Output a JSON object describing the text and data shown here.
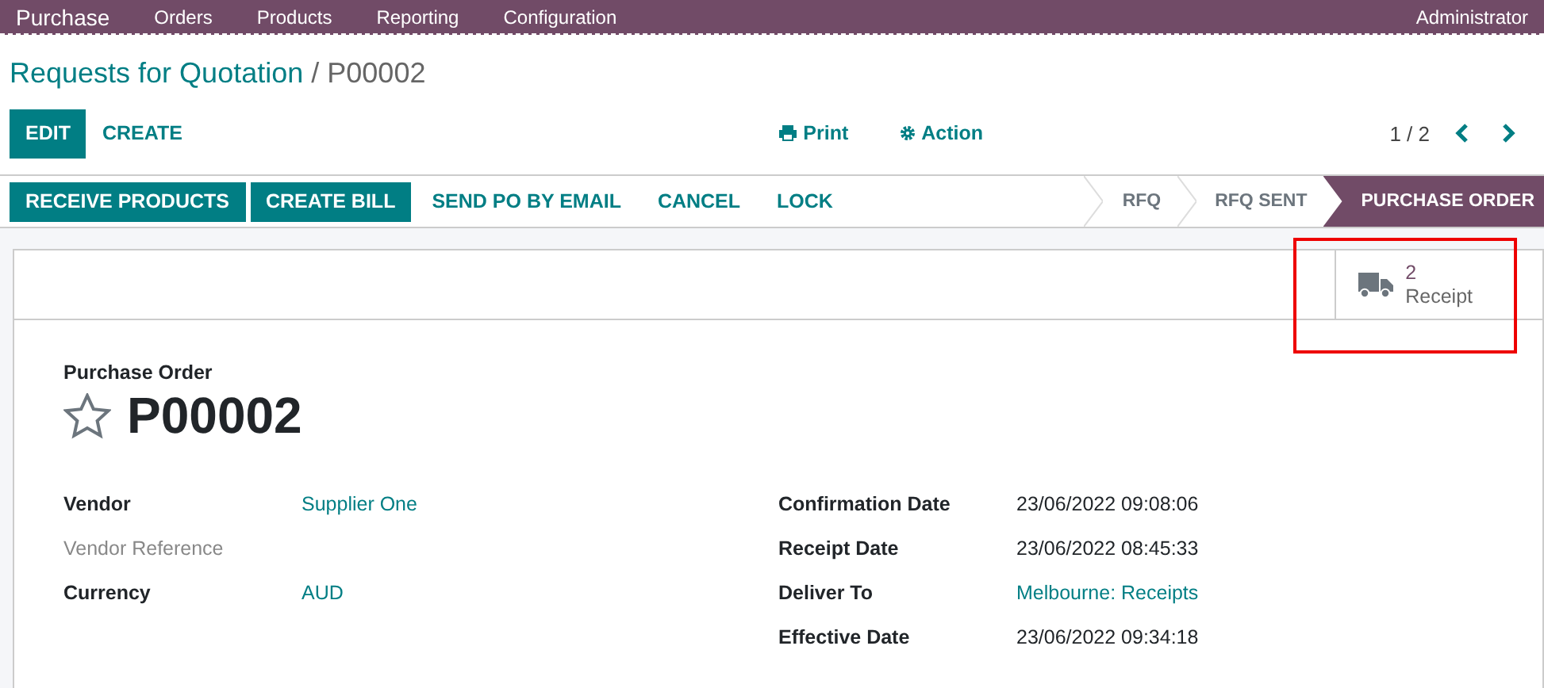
{
  "navbar": {
    "app": "Purchase",
    "menus": [
      "Orders",
      "Products",
      "Reporting",
      "Configuration"
    ],
    "user": "Administrator"
  },
  "breadcrumb": {
    "parent": "Requests for Quotation",
    "separator": "/",
    "current": "P00002"
  },
  "control_buttons": [
    {
      "label": "EDIT",
      "kind": "primary"
    },
    {
      "label": "CREATE",
      "kind": "link"
    }
  ],
  "actions": [
    {
      "label": "Print",
      "kind": "print"
    },
    {
      "label": "Action",
      "kind": "gear"
    }
  ],
  "pager": {
    "value": "1 / 2"
  },
  "header_buttons": [
    {
      "label": "RECEIVE PRODUCTS",
      "kind": "primary"
    },
    {
      "label": "CREATE BILL",
      "kind": "primary"
    },
    {
      "label": "SEND PO BY EMAIL",
      "kind": "link"
    },
    {
      "label": "CANCEL",
      "kind": "link"
    },
    {
      "label": "LOCK",
      "kind": "link"
    }
  ],
  "stages": [
    {
      "label": "RFQ",
      "selected": false
    },
    {
      "label": "RFQ SENT",
      "selected": false
    },
    {
      "label": "PURCHASE ORDER",
      "selected": true
    }
  ],
  "smart_button": {
    "count": "2",
    "label": "Receipt"
  },
  "form": {
    "subtitle": "Purchase Order",
    "title": "P00002",
    "starred": false,
    "left_fields": [
      {
        "label": "Vendor",
        "value": "Supplier One",
        "kind": "link"
      },
      {
        "label": "Vendor Reference",
        "kind": "empty"
      },
      {
        "label": "Currency",
        "value": "AUD",
        "kind": "link"
      }
    ],
    "right_fields": [
      {
        "label": "Confirmation Date",
        "value": "23/06/2022 09:08:06",
        "kind": "text"
      },
      {
        "label": "Receipt Date",
        "value": "23/06/2022 08:45:33",
        "kind": "text"
      },
      {
        "label": "Deliver To",
        "value": "Melbourne: Receipts",
        "kind": "link"
      },
      {
        "label": "Effective Date",
        "value": "23/06/2022 09:34:18",
        "kind": "text"
      }
    ]
  }
}
